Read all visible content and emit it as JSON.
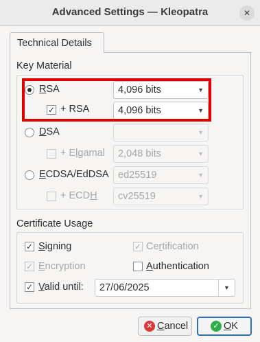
{
  "window": {
    "title": "Advanced Settings — Kleopatra",
    "close_glyph": "✕"
  },
  "tab": {
    "label": "Technical Details"
  },
  "key_material": {
    "title": "Key Material",
    "rsa": {
      "label": "RSA",
      "selected": true,
      "size": "4,096 bits"
    },
    "rsa_sub": {
      "label": "+ RSA",
      "checked": true,
      "size": "4,096 bits"
    },
    "dsa": {
      "label": "DSA",
      "selected": false,
      "size": ""
    },
    "elgamal": {
      "label": "+ Elgamal",
      "checked": false,
      "size": "2,048 bits"
    },
    "ecdsa": {
      "label": "ECDSA/EdDSA",
      "selected": false,
      "curve": "ed25519"
    },
    "ecdh": {
      "label": "+ ECDH",
      "checked": false,
      "curve": "cv25519"
    }
  },
  "certificate_usage": {
    "title": "Certificate Usage",
    "signing": {
      "label": "Signing",
      "checked": true
    },
    "certification": {
      "label": "Certification",
      "checked": true
    },
    "encryption": {
      "label": "Encryption",
      "checked": true
    },
    "authentication": {
      "label": "Authentication",
      "checked": false
    },
    "valid_until": {
      "label": "Valid until:",
      "checked": true,
      "date": "27/06/2025"
    }
  },
  "buttons": {
    "cancel": "Cancel",
    "ok": "OK"
  },
  "colors": {
    "highlight": "#e00000",
    "cancel_icon": "#d83a3a",
    "ok_icon": "#2eae4b",
    "ok_border": "#2c6fbd"
  },
  "icons": {
    "dropdown": "chevron-down-icon",
    "cancel": "cancel-icon",
    "ok": "check-circle-icon"
  }
}
